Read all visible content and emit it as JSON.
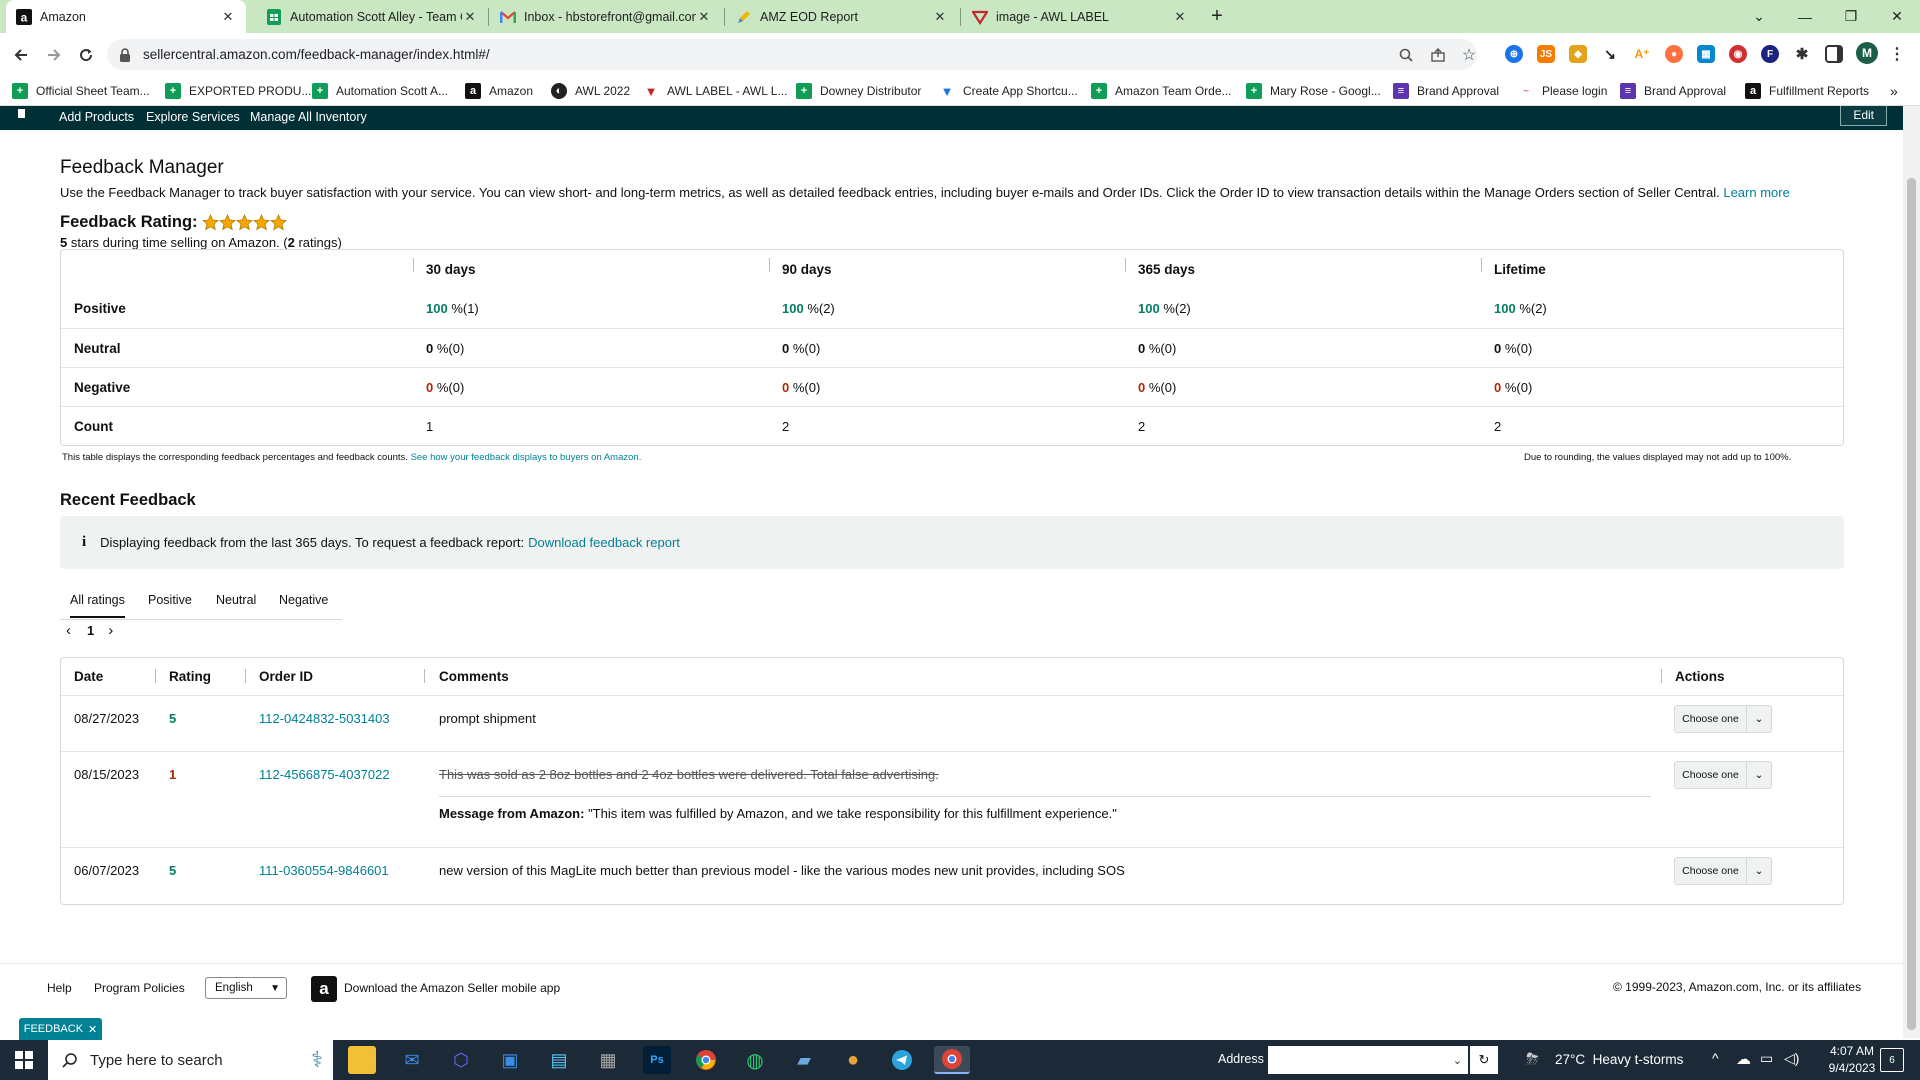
{
  "browser": {
    "tabs": [
      {
        "title": "Amazon",
        "icon": "amazon-icon"
      },
      {
        "title": "Automation Scott Alley - Team O",
        "icon": "sheets-icon"
      },
      {
        "title": "Inbox - hbstorefront@gmail.com",
        "icon": "gmail-icon"
      },
      {
        "title": "AMZ EOD Report",
        "icon": "pencil-icon"
      },
      {
        "title": "image - AWL LABEL",
        "icon": "awl-icon"
      }
    ],
    "url": "sellercentral.amazon.com/feedback-manager/index.html#/",
    "bookmarks": [
      "Official Sheet Team...",
      "EXPORTED PRODU...",
      "Automation Scott A...",
      "Amazon",
      "AWL 2022",
      "AWL LABEL - AWL L...",
      "Downey Distributor",
      "Create App Shortcu...",
      "Amazon Team Orde...",
      "Mary Rose - Googl...",
      "Brand Approval",
      "Please login",
      "Brand Approval",
      "Fulfillment Reports"
    ],
    "profile_initial": "M"
  },
  "seller_nav": {
    "items": [
      "Add Products",
      "Explore Services",
      "Manage All Inventory"
    ],
    "edit": "Edit"
  },
  "page": {
    "title": "Feedback Manager",
    "description": "Use the Feedback Manager to track buyer satisfaction with your service. You can view short- and long-term metrics, as well as detailed feedback entries, including buyer e-mails and Order IDs. Click the Order ID to view transaction details within the Manage Orders section of Seller Central.",
    "learn_more": "Learn more",
    "rating_label": "Feedback Rating:",
    "stars": 5,
    "rating_summary_a": "5",
    "rating_summary_b": " stars during time selling on Amazon. (",
    "rating_summary_c": "2",
    "rating_summary_d": " ratings)",
    "periods": [
      "30 days",
      "90 days",
      "365 days",
      "Lifetime"
    ],
    "rating_rows": [
      {
        "label": "Positive",
        "cells": [
          [
            "100",
            " %(1)"
          ],
          [
            "100",
            " %(2)"
          ],
          [
            "100",
            " %(2)"
          ],
          [
            "100",
            " %(2)"
          ]
        ]
      },
      {
        "label": "Neutral",
        "cells": [
          [
            "0",
            " %(0)"
          ],
          [
            "0",
            " %(0)"
          ],
          [
            "0",
            " %(0)"
          ],
          [
            "0",
            " %(0)"
          ]
        ]
      },
      {
        "label": "Negative",
        "cells": [
          [
            "0",
            " %(0)"
          ],
          [
            "0",
            " %(0)"
          ],
          [
            "0",
            " %(0)"
          ],
          [
            "0",
            " %(0)"
          ]
        ]
      },
      {
        "label": "Count",
        "cells": [
          [
            "1",
            ""
          ],
          [
            "2",
            ""
          ],
          [
            "2",
            ""
          ],
          [
            "2",
            ""
          ]
        ]
      }
    ],
    "table_note": "This table displays the corresponding feedback percentages and feedback counts.",
    "table_note_link": "See how your feedback displays to buyers on Amazon.",
    "rounding_note": "Due to rounding, the values displayed may not add up to 100%.",
    "recent_title": "Recent Feedback",
    "info_text": "Displaying feedback from the last 365 days. To request a feedback report:",
    "info_link": "Download feedback report",
    "filter_tabs": [
      "All ratings",
      "Positive",
      "Neutral",
      "Negative"
    ],
    "page_number": "1",
    "columns": [
      "Date",
      "Rating",
      "Order ID",
      "Comments",
      "Actions"
    ],
    "feedback": [
      {
        "date": "08/27/2023",
        "rating": "5",
        "order": "112-0424832-5031403",
        "comment": "prompt shipment",
        "action": "Choose one"
      },
      {
        "date": "08/15/2023",
        "rating": "1",
        "order": "112-4566875-4037022",
        "comment": "This was sold as 2 8oz bottles and 2 4oz bottles were delivered. Total false advertising.",
        "message_label": "Message from Amazon:",
        "message": "\"This item was fulfilled by Amazon, and we take responsibility for this fulfillment experience.\"",
        "action": "Choose one"
      },
      {
        "date": "06/07/2023",
        "rating": "5",
        "order": "111-0360554-9846601",
        "comment": "new version of this MagLite much better than previous model - like the various modes new unit provides, including SOS",
        "action": "Choose one"
      }
    ]
  },
  "footer": {
    "help": "Help",
    "policies": "Program Policies",
    "language": "English",
    "app_link": "Download the Amazon Seller mobile app",
    "copyright": "© 1999-2023, Amazon.com, Inc. or its affiliates",
    "feedback_tab": "FEEDBACK"
  },
  "taskbar": {
    "search_placeholder": "Type here to search",
    "address_label": "Address",
    "weather": "27°C  Heavy t-storms",
    "time": "4:07 AM",
    "date": "9/4/2023",
    "notification_count": "6"
  },
  "colors": {
    "seller_nav_bg": "#002f36",
    "link": "#008296",
    "positive": "#067d62",
    "negative": "#b12704",
    "tabbar_bg": "#c9e7c3",
    "star": "#f7a800"
  }
}
